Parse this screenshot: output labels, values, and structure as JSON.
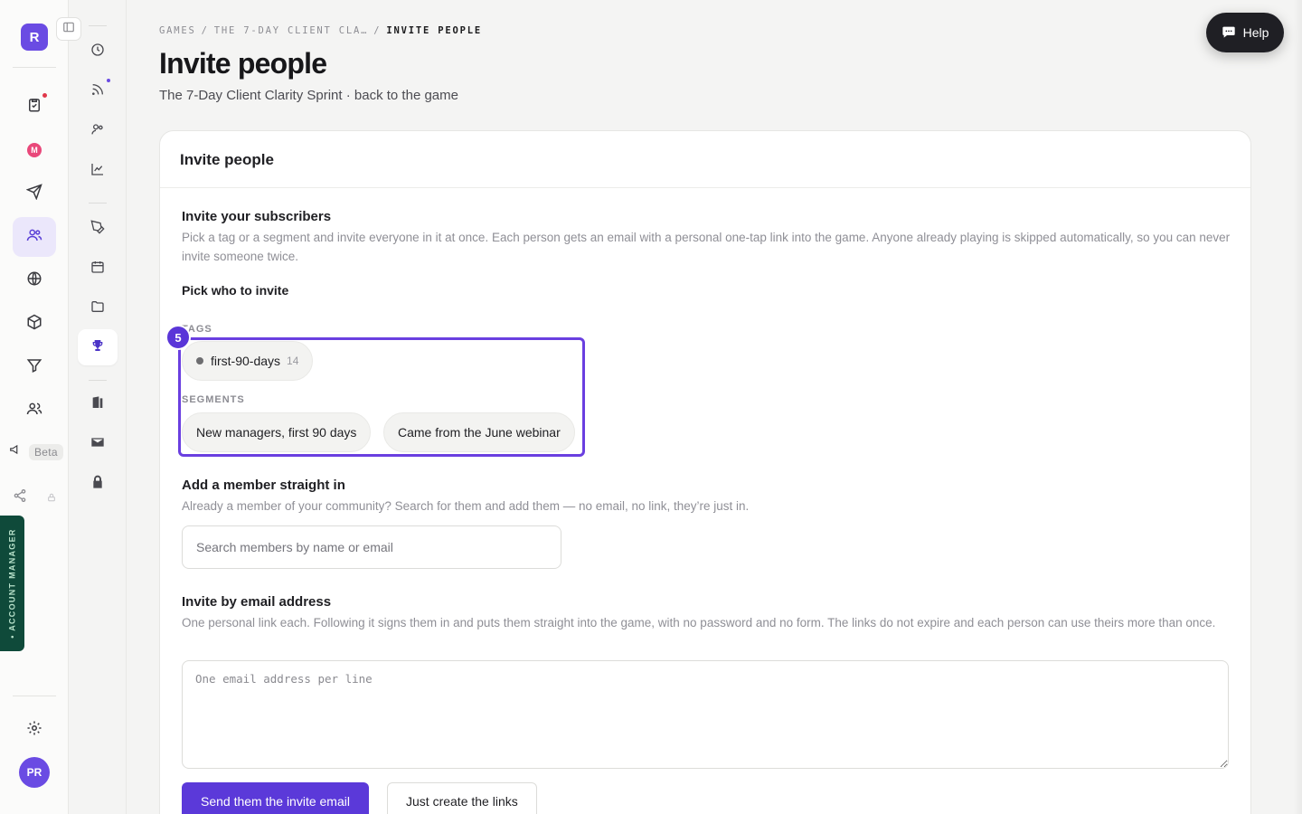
{
  "app": {
    "brand_letter": "R",
    "user_initials": "PR",
    "mail_badge": "M"
  },
  "rail": {
    "beta_label": "Beta",
    "account_manager": "• ACCOUNT MANAGER"
  },
  "breadcrumb": {
    "items": [
      "GAMES",
      "THE 7-DAY CLIENT CLA…",
      "INVITE PEOPLE"
    ],
    "separator": "/"
  },
  "page": {
    "title": "Invite people",
    "subtitle_prefix": "The 7-Day Client Clarity Sprint · ",
    "subtitle_link": "back to the game"
  },
  "card": {
    "title": "Invite people",
    "subscribers": {
      "title": "Invite your subscribers",
      "description": "Pick a tag or a segment and invite everyone in it at once. Each person gets an email with a personal one-tap link into the game. Anyone already playing is skipped automatically, so you can never invite someone twice.",
      "pick_title": "Pick who to invite",
      "step_badge": "5",
      "tags_label": "TAGS",
      "tags": [
        {
          "name": "first-90-days",
          "count": "14"
        }
      ],
      "segments_label": "SEGMENTS",
      "segments": [
        "New managers, first 90 days",
        "Came from the June webinar"
      ]
    },
    "member": {
      "title": "Add a member straight in",
      "description": "Already a member of your community? Search for them and add them — no email, no link, they’re just in.",
      "search_placeholder": "Search members by name or email"
    },
    "email": {
      "title": "Invite by email address",
      "description": "One personal link each. Following it signs them in and puts them straight into the game, with no password and no form. The links do not expire and each person can use theirs more than once.",
      "placeholder": "One email address per line",
      "send_label": "Send them the invite email",
      "links_label": "Just create the links"
    }
  },
  "help": {
    "label": "Help"
  },
  "colors": {
    "accent": "#5b39d9",
    "highlight": "#6a3fe0",
    "account_manager_bg": "#0f4a3a"
  }
}
